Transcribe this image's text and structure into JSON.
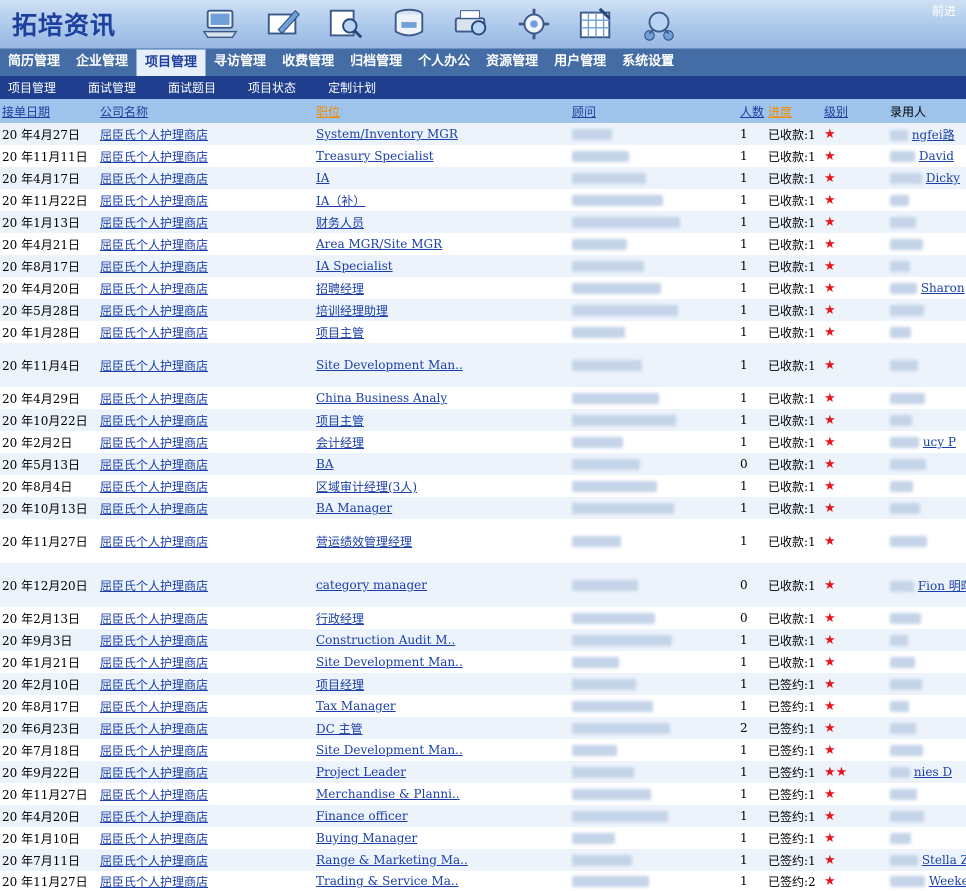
{
  "app": {
    "logo": "拓培资讯",
    "forward_label": "前进"
  },
  "toolbar_icons": [
    "laptop-icon",
    "edit-icon",
    "search-icon",
    "database-icon",
    "print-icon",
    "settings-icon",
    "calendar-icon",
    "network-icon"
  ],
  "main_nav": [
    {
      "label": "简历管理",
      "active": false
    },
    {
      "label": "企业管理",
      "active": false
    },
    {
      "label": "项目管理",
      "active": true
    },
    {
      "label": "寻访管理",
      "active": false
    },
    {
      "label": "收费管理",
      "active": false
    },
    {
      "label": "归档管理",
      "active": false
    },
    {
      "label": "个人办公",
      "active": false
    },
    {
      "label": "资源管理",
      "active": false
    },
    {
      "label": "用户管理",
      "active": false
    },
    {
      "label": "系统设置",
      "active": false
    }
  ],
  "sub_nav": [
    "项目管理",
    "面试管理",
    "面试题目",
    "项目状态",
    "定制计划"
  ],
  "table": {
    "columns": {
      "date": "接单日期",
      "company": "公司名称",
      "position": "职位",
      "consultant": "顾问",
      "count": "人数",
      "progress": "进度",
      "level": "级别",
      "hired": "录用人"
    },
    "rows": [
      {
        "date": "20 年4月27日",
        "company": "屈臣氏个人护理商店",
        "position": "System/Inventory MGR",
        "count": "1",
        "progress": "已收款:1",
        "stars": "★",
        "hired": "ngfei路",
        "h": 22
      },
      {
        "date": "20 年11月11日",
        "company": "屈臣氏个人护理商店",
        "position": "Treasury Specialist",
        "count": "1",
        "progress": "已收款:1",
        "stars": "★",
        "hired": "David",
        "h": 22
      },
      {
        "date": "20 年4月17日",
        "company": "屈臣氏个人护理商店",
        "position": "IA",
        "count": "1",
        "progress": "已收款:1",
        "stars": "★",
        "hired": "Dicky",
        "h": 22
      },
      {
        "date": "20 年11月22日",
        "company": "屈臣氏个人护理商店",
        "position": "IA（补）",
        "count": "1",
        "progress": "已收款:1",
        "stars": "★",
        "hired": "",
        "h": 22
      },
      {
        "date": "20 年1月13日",
        "company": "屈臣氏个人护理商店",
        "position": "财务人员",
        "count": "1",
        "progress": "已收款:1",
        "stars": "★",
        "hired": "",
        "h": 22
      },
      {
        "date": "20 年4月21日",
        "company": "屈臣氏个人护理商店",
        "position": "Area MGR/Site MGR",
        "count": "1",
        "progress": "已收款:1",
        "stars": "★",
        "hired": "",
        "h": 22
      },
      {
        "date": "20 年8月17日",
        "company": "屈臣氏个人护理商店",
        "position": "IA Specialist",
        "count": "1",
        "progress": "已收款:1",
        "stars": "★",
        "hired": "",
        "h": 22
      },
      {
        "date": "20 年4月20日",
        "company": "屈臣氏个人护理商店",
        "position": "招聘经理",
        "count": "1",
        "progress": "已收款:1",
        "stars": "★",
        "hired": "Sharon",
        "h": 22
      },
      {
        "date": "20 年5月28日",
        "company": "屈臣氏个人护理商店",
        "position": "培训经理助理",
        "count": "1",
        "progress": "已收款:1",
        "stars": "★",
        "hired": "",
        "h": 22
      },
      {
        "date": "20 年1月28日",
        "company": "屈臣氏个人护理商店",
        "position": "项目主管",
        "count": "1",
        "progress": "已收款:1",
        "stars": "★",
        "hired": "",
        "h": 22
      },
      {
        "date": "20 年11月4日",
        "company": "屈臣氏个人护理商店",
        "position": "Site Development Man..",
        "count": "1",
        "progress": "已收款:1",
        "stars": "★",
        "hired": "",
        "h": 44
      },
      {
        "date": "20 年4月29日",
        "company": "屈臣氏个人护理商店",
        "position": "China Business Analy",
        "count": "1",
        "progress": "已收款:1",
        "stars": "★",
        "hired": "",
        "h": 22
      },
      {
        "date": "20 年10月22日",
        "company": "屈臣氏个人护理商店",
        "position": "项目主管",
        "count": "1",
        "progress": "已收款:1",
        "stars": "★",
        "hired": "",
        "h": 22
      },
      {
        "date": "20 年2月2日",
        "company": "屈臣氏个人护理商店",
        "position": "会计经理",
        "count": "1",
        "progress": "已收款:1",
        "stars": "★",
        "hired": "ucy P",
        "h": 22
      },
      {
        "date": "20 年5月13日",
        "company": "屈臣氏个人护理商店",
        "position": "BA",
        "count": "0",
        "progress": "已收款:1",
        "stars": "★",
        "hired": "",
        "h": 22
      },
      {
        "date": "20 年8月4日",
        "company": "屈臣氏个人护理商店",
        "position": "区域审计经理(3人)",
        "count": "1",
        "progress": "已收款:1",
        "stars": "★",
        "hired": "",
        "h": 22
      },
      {
        "date": "20 年10月13日",
        "company": "屈臣氏个人护理商店",
        "position": "BA Manager",
        "count": "1",
        "progress": "已收款:1",
        "stars": "★",
        "hired": "",
        "h": 22
      },
      {
        "date": "20 年11月27日",
        "company": "屈臣氏个人护理商店",
        "position": "营运绩效管理经理",
        "count": "1",
        "progress": "已收款:1",
        "stars": "★",
        "hired": "",
        "h": 44
      },
      {
        "date": "20 年12月20日",
        "company": "屈臣氏个人护理商店",
        "position": "category manager",
        "count": "0",
        "progress": "已收款:1",
        "stars": "★",
        "hired": "Fion 明晖",
        "h": 44
      },
      {
        "date": "20 年2月13日",
        "company": "屈臣氏个人护理商店",
        "position": "行政经理",
        "count": "0",
        "progress": "已收款:1",
        "stars": "★",
        "hired": "",
        "h": 22
      },
      {
        "date": "20 年9月3日",
        "company": "屈臣氏个人护理商店",
        "position": "Construction Audit M..",
        "count": "1",
        "progress": "已收款:1",
        "stars": "★",
        "hired": "",
        "h": 22
      },
      {
        "date": "20 年1月21日",
        "company": "屈臣氏个人护理商店",
        "position": "Site Development Man..",
        "count": "1",
        "progress": "已收款:1",
        "stars": "★",
        "hired": "",
        "h": 22
      },
      {
        "date": "20 年2月10日",
        "company": "屈臣氏个人护理商店",
        "position": "项目经理",
        "count": "1",
        "progress": "已签约:1",
        "stars": "★",
        "hired": "",
        "h": 22
      },
      {
        "date": "20 年8月17日",
        "company": "屈臣氏个人护理商店",
        "position": "Tax Manager",
        "count": "1",
        "progress": "已签约:1",
        "stars": "★",
        "hired": "",
        "h": 22
      },
      {
        "date": "20 年6月23日",
        "company": "屈臣氏个人护理商店",
        "position": "DC 主管",
        "count": "2",
        "progress": "已签约:1",
        "stars": "★",
        "hired": "",
        "h": 22
      },
      {
        "date": "20 年7月18日",
        "company": "屈臣氏个人护理商店",
        "position": "Site Development Man..",
        "count": "1",
        "progress": "已签约:1",
        "stars": "★",
        "hired": "",
        "h": 22
      },
      {
        "date": "20 年9月22日",
        "company": "屈臣氏个人护理商店",
        "position": "Project Leader",
        "count": "1",
        "progress": "已签约:1",
        "stars": "★★",
        "hired": "nies D",
        "h": 22
      },
      {
        "date": "20 年11月27日",
        "company": "屈臣氏个人护理商店",
        "position": "Merchandise & Planni..",
        "count": "1",
        "progress": "已签约:1",
        "stars": "★",
        "hired": "",
        "h": 22
      },
      {
        "date": "20 年4月20日",
        "company": "屈臣氏个人护理商店",
        "position": "Finance officer",
        "count": "1",
        "progress": "已签约:1",
        "stars": "★",
        "hired": "",
        "h": 22
      },
      {
        "date": "20 年1月10日",
        "company": "屈臣氏个人护理商店",
        "position": "Buying Manager",
        "count": "1",
        "progress": "已签约:1",
        "stars": "★",
        "hired": "",
        "h": 22
      },
      {
        "date": "20 年7月11日",
        "company": "屈臣氏个人护理商店",
        "position": "Range & Marketing Ma..",
        "count": "1",
        "progress": "已签约:1",
        "stars": "★",
        "hired": "Stella Z",
        "h": 22
      },
      {
        "date": "20 年11月27日",
        "company": "屈臣氏个人护理商店",
        "position": "Trading & Service Ma..",
        "count": "1",
        "progress": "已签约:2",
        "stars": "★",
        "hired": "Weeke",
        "h": 20
      }
    ]
  },
  "colors": {
    "header_bg": "#a9c6ea",
    "nav_bg": "#436da4",
    "subnav_bg": "#1f3e8e",
    "table_head": "#9fc4ec",
    "row_alt": "#ecf3fb",
    "link": "#1a3fa8",
    "star": "#e8141b",
    "orange": "#f08c00"
  }
}
